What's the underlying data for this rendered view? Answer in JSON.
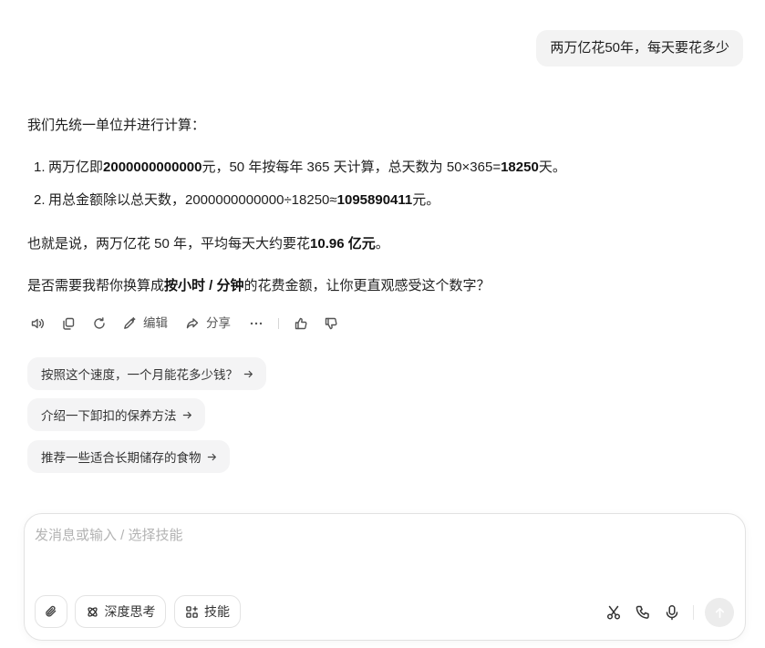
{
  "theme": {
    "text": "#1f1f1f",
    "muted": "#555555",
    "bubble_bg": "#f3f3f3",
    "chip_bg": "#f4f4f5",
    "border": "#e2e2e2",
    "placeholder": "#b3b3b3"
  },
  "user_message": {
    "text": "两万亿花50年，每天要花多少"
  },
  "assistant": {
    "intro": "我们先统一单位并进行计算：",
    "steps": [
      {
        "number": "1.",
        "parts": [
          "两万亿即",
          "2000000000000",
          "元，50 年按每年 365 天计算，总天数为 50×365=",
          "18250",
          "天。"
        ]
      },
      {
        "number": "2.",
        "parts": [
          "用总金额除以总天数，2000000000000÷18250≈",
          "1095890411",
          "元。"
        ]
      }
    ],
    "conclusion": {
      "parts": [
        "也就是说，两万亿花 50 年，平均每天大约要花",
        "10.96 亿元",
        "。"
      ]
    },
    "follow_up": {
      "parts": [
        "是否需要我帮你换算成",
        "按小时 / 分钟",
        "的花费金额，让你更直观感受这个数字？"
      ]
    }
  },
  "actions": {
    "icons": [
      "speaker-icon",
      "copy-icon",
      "refresh-icon",
      "pen-icon",
      "share-icon",
      "more-icon",
      "thumbs-up-icon",
      "thumbs-down-icon"
    ],
    "edit_label": "编辑",
    "share_label": "分享"
  },
  "suggestions": [
    "按照这个速度，一个月能花多少钱？",
    "介绍一下卸扣的保养方法",
    "推荐一些适合长期储存的食物"
  ],
  "composer": {
    "placeholder": "发消息或输入 / 选择技能",
    "deep_think_label": "深度思考",
    "skills_label": "技能",
    "icons": [
      "paperclip-icon",
      "atom-icon",
      "grid-plus-icon",
      "scissors-icon",
      "phone-icon",
      "mic-icon",
      "send-arrow-icon"
    ]
  }
}
